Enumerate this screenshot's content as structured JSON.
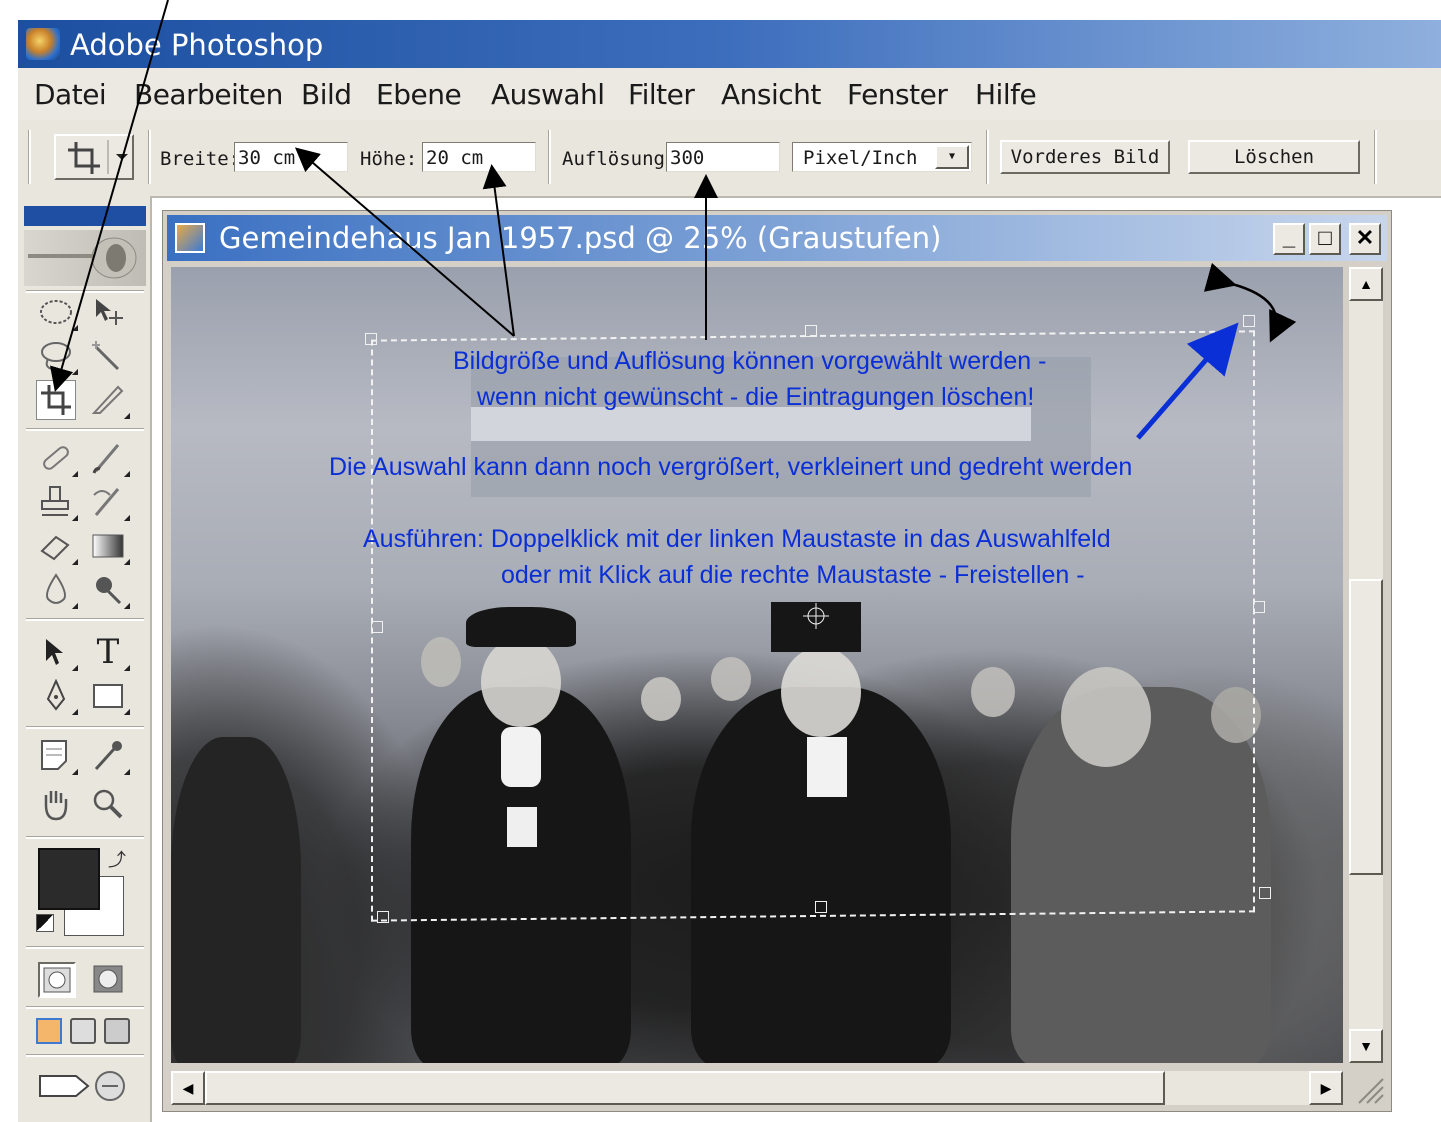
{
  "app": {
    "title": "Adobe Photoshop"
  },
  "menu": [
    "Datei",
    "Bearbeiten",
    "Bild",
    "Ebene",
    "Auswahl",
    "Filter",
    "Ansicht",
    "Fenster",
    "Hilfe"
  ],
  "options": {
    "breite_label": "Breite:",
    "breite_value": "30 cm",
    "hoehe_label": "Höhe:",
    "hoehe_value": "20 cm",
    "aufloesung_label": "Auflösung:",
    "aufloesung_value": "300",
    "unit_select": "Pixel/Inch",
    "front_image_button": "Vorderes Bild",
    "clear_button": "Löschen"
  },
  "document": {
    "title": "Gemeindehaus Jan 1957.psd @ 25% (Graustufen)",
    "minimize": "_",
    "maximize": "□",
    "close": "✕"
  },
  "annotations": {
    "line1": "Bildgröße und Auflösung können vorgewählt werden -",
    "line2": "wenn nicht gewünscht - die Eintragungen löschen!",
    "line3": "Die Auswahl kann dann noch vergrößert, verkleinert und gedreht werden",
    "line4": "Ausführen: Doppelklick mit der linken Maustaste in das Auswahlfeld",
    "line5": "oder mit Klick auf die rechte Maustaste - Freistellen -"
  },
  "colors": {
    "annotation": "#0b2fd6",
    "titlebar": "#1c4fa0",
    "foreground": "#2b2b2b",
    "background": "#ffffff"
  },
  "icons": [
    "marquee-icon",
    "move-icon",
    "lasso-icon",
    "magic-wand-icon",
    "crop-icon",
    "slice-icon",
    "healing-brush-icon",
    "brush-icon",
    "stamp-icon",
    "history-brush-icon",
    "eraser-icon",
    "gradient-icon",
    "blur-icon",
    "dodge-icon",
    "path-select-icon",
    "type-icon",
    "pen-icon",
    "shape-icon",
    "notes-icon",
    "eyedropper-icon",
    "hand-icon",
    "zoom-icon"
  ]
}
